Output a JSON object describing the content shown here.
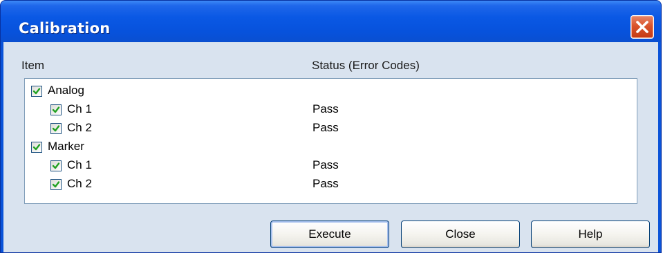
{
  "window": {
    "title": "Calibration",
    "close_icon": "close-icon",
    "accent": "#0a53d8",
    "client_bg": "#d9e3ef"
  },
  "columns": {
    "item": "Item",
    "status": "Status (Error Codes)"
  },
  "tree": {
    "check_color": "#21a121",
    "rows": [
      {
        "label": "Analog",
        "checked": true,
        "level": 0,
        "status": ""
      },
      {
        "label": "Ch 1",
        "checked": true,
        "level": 1,
        "status": "Pass"
      },
      {
        "label": "Ch 2",
        "checked": true,
        "level": 1,
        "status": "Pass"
      },
      {
        "label": "Marker",
        "checked": true,
        "level": 0,
        "status": ""
      },
      {
        "label": "Ch 1",
        "checked": true,
        "level": 1,
        "status": "Pass"
      },
      {
        "label": "Ch 2",
        "checked": true,
        "level": 1,
        "status": "Pass"
      }
    ]
  },
  "buttons": {
    "execute": "Execute",
    "close": "Close",
    "help": "Help"
  }
}
